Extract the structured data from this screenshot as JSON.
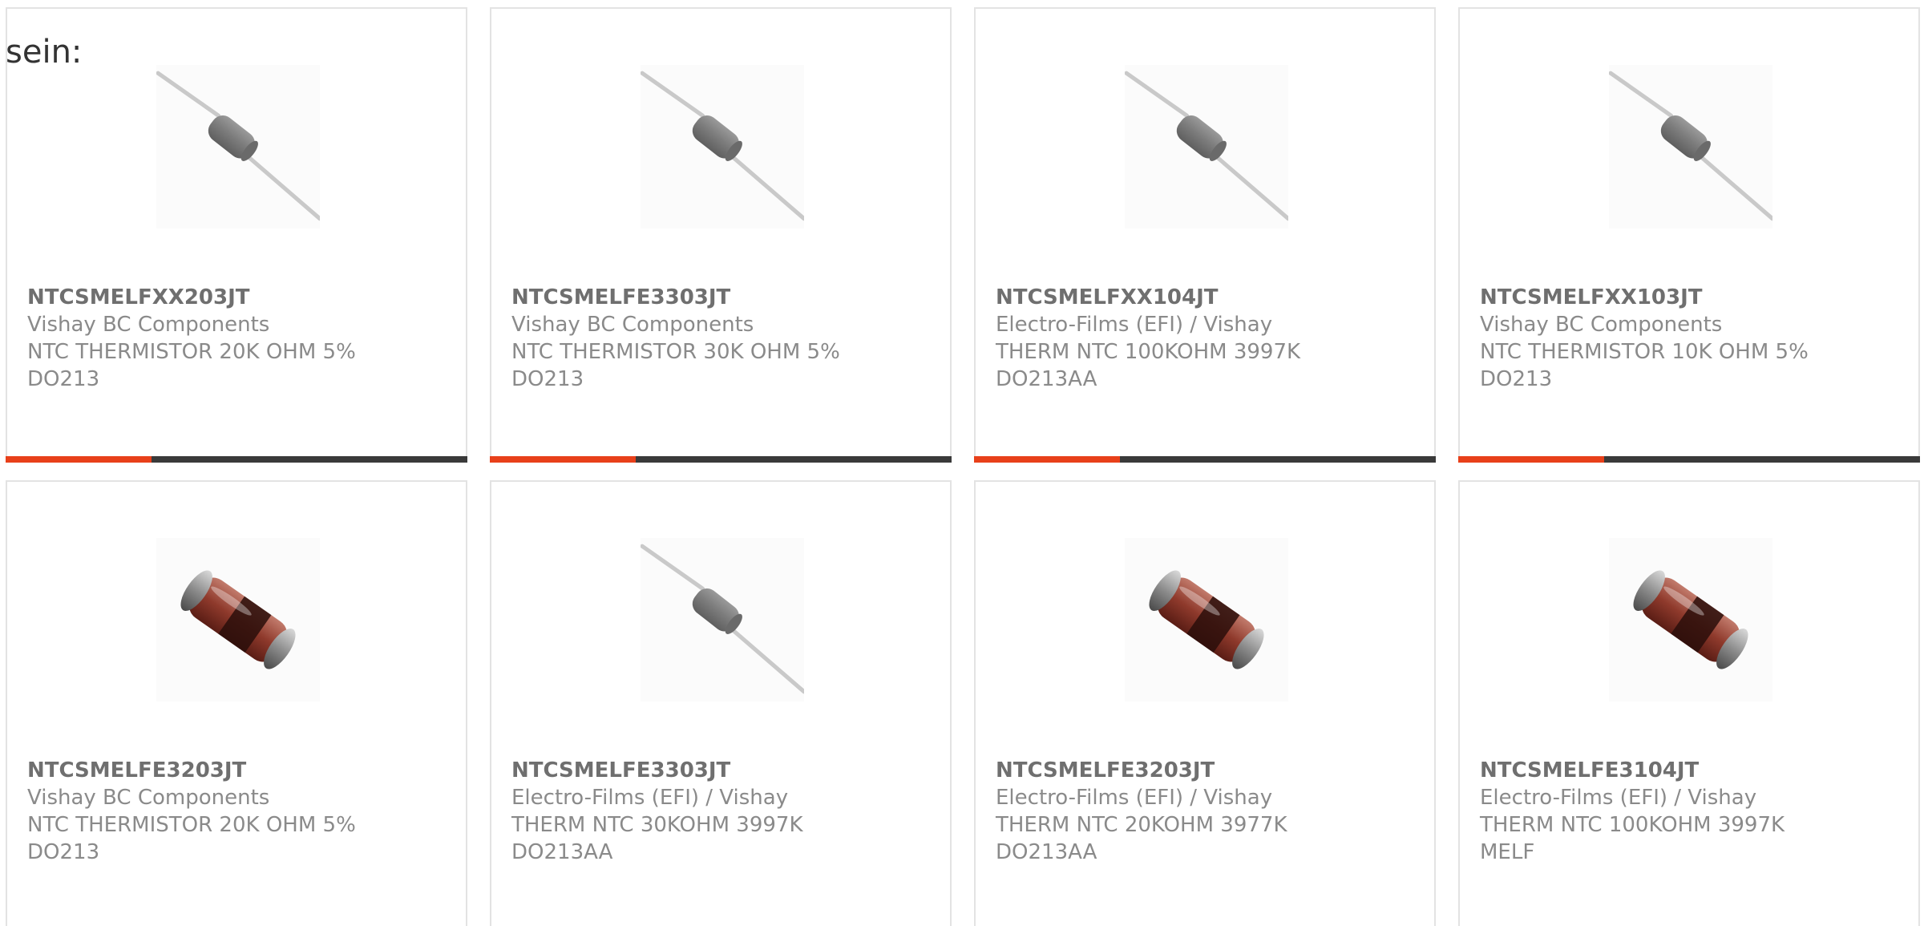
{
  "intro_text": "sein:",
  "colors": {
    "accent_red": "#e8401a",
    "accent_dark": "#3a3a3a",
    "text_grey": "#8a8a8a",
    "card_border": "#e3e3e3"
  },
  "products": [
    {
      "part_number": "NTCSMELFXX203JT",
      "manufacturer": "Vishay BC Components",
      "description": "NTC THERMISTOR 20K OHM 5%",
      "package": "DO213",
      "image": "axial-thermistor-icon"
    },
    {
      "part_number": "NTCSMELFE3303JT",
      "manufacturer": "Vishay BC Components",
      "description": "NTC THERMISTOR 30K OHM 5%",
      "package": "DO213",
      "image": "axial-thermistor-icon"
    },
    {
      "part_number": "NTCSMELFXX104JT",
      "manufacturer": "Electro-Films (EFI) / Vishay",
      "description": "THERM NTC 100KOHM 3997K",
      "package": "DO213AA",
      "image": "axial-thermistor-icon"
    },
    {
      "part_number": "NTCSMELFXX103JT",
      "manufacturer": "Vishay BC Components",
      "description": "NTC THERMISTOR 10K OHM 5%",
      "package": "DO213",
      "image": "axial-thermistor-icon"
    },
    {
      "part_number": "NTCSMELFE3203JT",
      "manufacturer": "Vishay BC Components",
      "description": "NTC THERMISTOR 20K OHM 5%",
      "package": "DO213",
      "image": "melf-thermistor-icon"
    },
    {
      "part_number": "NTCSMELFE3303JT",
      "manufacturer": "Electro-Films (EFI) / Vishay",
      "description": "THERM NTC 30KOHM 3997K",
      "package": "DO213AA",
      "image": "axial-thermistor-icon"
    },
    {
      "part_number": "NTCSMELFE3203JT",
      "manufacturer": "Electro-Films (EFI) / Vishay",
      "description": "THERM NTC 20KOHM 3977K",
      "package": "DO213AA",
      "image": "melf-thermistor-icon"
    },
    {
      "part_number": "NTCSMELFE3104JT",
      "manufacturer": "Electro-Films (EFI) / Vishay",
      "description": "THERM NTC 100KOHM 3997K",
      "package": "MELF",
      "image": "melf-thermistor-icon"
    }
  ]
}
